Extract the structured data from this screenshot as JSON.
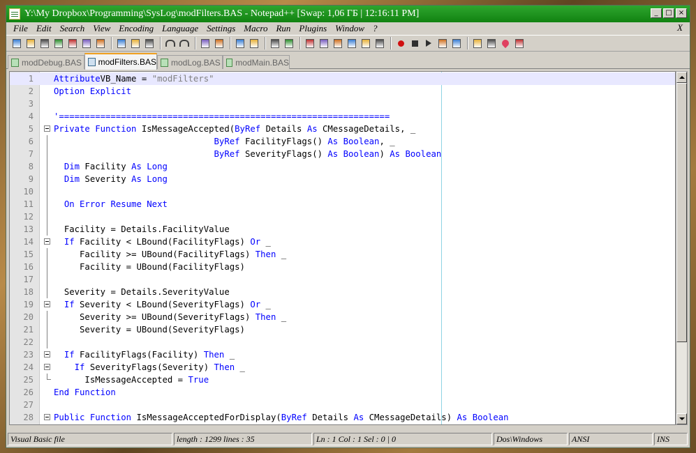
{
  "window": {
    "title": "Y:\\My Dropbox\\Programming\\SysLog\\modFilters.BAS - Notepad++ [Swap: 1,06 ГБ | 12:16:11 PM]",
    "min_label": "_",
    "max_label": "□",
    "close_label": "×"
  },
  "menu": {
    "items": [
      "File",
      "Edit",
      "Search",
      "View",
      "Encoding",
      "Language",
      "Settings",
      "Macro",
      "Run",
      "Plugins",
      "Window",
      "?"
    ],
    "close_doc": "X"
  },
  "toolbar": {
    "icons": [
      "new-file-icon",
      "open-file-icon",
      "save-icon",
      "save-all-icon",
      "close-icon",
      "close-all-icon",
      "print-icon",
      "cut-icon",
      "copy-icon",
      "paste-icon",
      "undo-icon",
      "redo-icon",
      "find-icon",
      "replace-icon",
      "zoom-in-icon",
      "zoom-out-icon",
      "sync-v-icon",
      "sync-h-icon",
      "word-wrap-icon",
      "show-all-chars-icon",
      "indent-guide-icon",
      "user-lang-icon",
      "doc-map-icon",
      "function-list-icon",
      "record-macro-icon",
      "stop-macro-icon",
      "play-macro-icon",
      "run-macro-multiple-icon",
      "save-macro-icon",
      "spellcheck-icon",
      "doc-monitor-icon",
      "favorites-icon",
      "plugin-icon"
    ]
  },
  "tabs": [
    {
      "label": "modDebug.BAS",
      "active": false
    },
    {
      "label": "modFilters.BAS",
      "active": true
    },
    {
      "label": "modLog.BAS",
      "active": false
    },
    {
      "label": "modMain.BAS",
      "active": false
    }
  ],
  "editor": {
    "current_line": 1,
    "lines": [
      {
        "n": "1",
        "fold": "",
        "indent": "",
        "tokens": [
          [
            "kw",
            "Attribute"
          ],
          [
            "",
            "VB_Name = "
          ],
          [
            "str",
            "\"modFilters\""
          ]
        ]
      },
      {
        "n": "2",
        "fold": "",
        "indent": "",
        "tokens": [
          [
            "kw",
            "Option Explicit"
          ]
        ]
      },
      {
        "n": "3",
        "fold": "",
        "indent": "",
        "tokens": []
      },
      {
        "n": "4",
        "fold": "",
        "indent": "",
        "tokens": [
          [
            "kw",
            "'================================================================"
          ]
        ]
      },
      {
        "n": "5",
        "fold": "box",
        "indent": "",
        "tokens": [
          [
            "kw",
            "Private Function"
          ],
          [
            "",
            " IsMessageAccepted("
          ],
          [
            "kw",
            "ByRef"
          ],
          [
            "",
            " Details "
          ],
          [
            "kw",
            "As"
          ],
          [
            "",
            " CMessageDetails, _"
          ]
        ]
      },
      {
        "n": "6",
        "fold": "line",
        "indent": "                               ",
        "tokens": [
          [
            "kw",
            "ByRef"
          ],
          [
            "",
            " FacilityFlags() "
          ],
          [
            "kw",
            "As Boolean"
          ],
          [
            "",
            ", _"
          ]
        ]
      },
      {
        "n": "7",
        "fold": "line",
        "indent": "                               ",
        "tokens": [
          [
            "kw",
            "ByRef"
          ],
          [
            "",
            " SeverityFlags() "
          ],
          [
            "kw",
            "As Boolean"
          ],
          [
            "",
            ") "
          ],
          [
            "kw",
            "As Boolean"
          ]
        ]
      },
      {
        "n": "8",
        "fold": "line",
        "indent": "  ",
        "tokens": [
          [
            "kw",
            "Dim"
          ],
          [
            "",
            " Facility "
          ],
          [
            "kw",
            "As Long"
          ]
        ]
      },
      {
        "n": "9",
        "fold": "line",
        "indent": "  ",
        "tokens": [
          [
            "kw",
            "Dim"
          ],
          [
            "",
            " Severity "
          ],
          [
            "kw",
            "As Long"
          ]
        ]
      },
      {
        "n": "10",
        "fold": "line",
        "indent": "",
        "tokens": []
      },
      {
        "n": "11",
        "fold": "line",
        "indent": "  ",
        "tokens": [
          [
            "kw",
            "On Error Resume Next"
          ]
        ]
      },
      {
        "n": "12",
        "fold": "line",
        "indent": "",
        "tokens": []
      },
      {
        "n": "13",
        "fold": "line",
        "indent": "  ",
        "tokens": [
          [
            "",
            "Facility = Details.FacilityValue"
          ]
        ]
      },
      {
        "n": "14",
        "fold": "box",
        "indent": "  ",
        "tokens": [
          [
            "kw",
            "If"
          ],
          [
            "",
            " Facility < LBound(FacilityFlags) "
          ],
          [
            "kw",
            "Or"
          ],
          [
            "",
            " _"
          ]
        ]
      },
      {
        "n": "15",
        "fold": "line",
        "indent": "     ",
        "tokens": [
          [
            "",
            "Facility >= UBound(FacilityFlags) "
          ],
          [
            "kw",
            "Then"
          ],
          [
            "",
            " _"
          ]
        ]
      },
      {
        "n": "16",
        "fold": "line",
        "indent": "     ",
        "tokens": [
          [
            "",
            "Facility = UBound(FacilityFlags)"
          ]
        ]
      },
      {
        "n": "17",
        "fold": "line",
        "indent": "",
        "tokens": []
      },
      {
        "n": "18",
        "fold": "line",
        "indent": "  ",
        "tokens": [
          [
            "",
            "Severity = Details.SeverityValue"
          ]
        ]
      },
      {
        "n": "19",
        "fold": "box",
        "indent": "  ",
        "tokens": [
          [
            "kw",
            "If"
          ],
          [
            "",
            " Severity < LBound(SeverityFlags) "
          ],
          [
            "kw",
            "Or"
          ],
          [
            "",
            " _"
          ]
        ]
      },
      {
        "n": "20",
        "fold": "line",
        "indent": "     ",
        "tokens": [
          [
            "",
            "Severity >= UBound(SeverityFlags) "
          ],
          [
            "kw",
            "Then"
          ],
          [
            "",
            " _"
          ]
        ]
      },
      {
        "n": "21",
        "fold": "line",
        "indent": "     ",
        "tokens": [
          [
            "",
            "Severity = UBound(SeverityFlags)"
          ]
        ]
      },
      {
        "n": "22",
        "fold": "line",
        "indent": "",
        "tokens": []
      },
      {
        "n": "23",
        "fold": "box",
        "indent": "  ",
        "tokens": [
          [
            "kw",
            "If"
          ],
          [
            "",
            " FacilityFlags(Facility) "
          ],
          [
            "kw",
            "Then"
          ],
          [
            "",
            " _"
          ]
        ]
      },
      {
        "n": "24",
        "fold": "box",
        "indent": "    ",
        "tokens": [
          [
            "kw",
            "If"
          ],
          [
            "",
            " SeverityFlags(Severity) "
          ],
          [
            "kw",
            "Then"
          ],
          [
            "",
            " _"
          ]
        ]
      },
      {
        "n": "25",
        "fold": "end",
        "indent": "      ",
        "tokens": [
          [
            "",
            "IsMessageAccepted = "
          ],
          [
            "kw",
            "True"
          ]
        ]
      },
      {
        "n": "26",
        "fold": "",
        "indent": "",
        "tokens": [
          [
            "kw",
            "End Function"
          ]
        ]
      },
      {
        "n": "27",
        "fold": "",
        "indent": "",
        "tokens": []
      },
      {
        "n": "28",
        "fold": "box",
        "indent": "",
        "tokens": [
          [
            "kw",
            "Public Function"
          ],
          [
            "",
            " IsMessageAcceptedForDisplay("
          ],
          [
            "kw",
            "ByRef"
          ],
          [
            "",
            " Details "
          ],
          [
            "kw",
            "As"
          ],
          [
            "",
            " CMessageDetails) "
          ],
          [
            "kw",
            "As Boolean"
          ]
        ]
      }
    ]
  },
  "status": {
    "file_type": "Visual Basic file",
    "length": "length : 1299    lines : 35",
    "position": "Ln : 1    Col : 1    Sel : 0 | 0",
    "eol": "Dos\\Windows",
    "encoding": "ANSI",
    "mode": "INS"
  },
  "colors": {
    "keyword": "#0000ff",
    "string": "#808080",
    "title_bar": "#1a8f1a",
    "current_line": "#e8e8ff",
    "edge_line": "#8ed4e4"
  }
}
